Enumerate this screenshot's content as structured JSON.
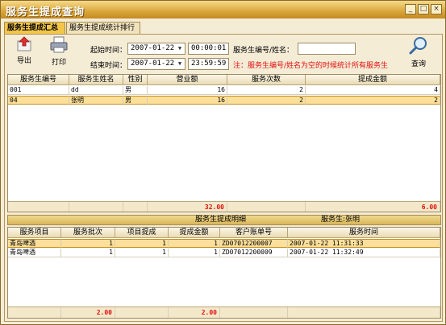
{
  "window": {
    "title": "服务生提成查询",
    "min": "_",
    "max": "□",
    "close": "×"
  },
  "tabs": [
    {
      "label": "服务生提成汇总"
    },
    {
      "label": "服务生提成统计排行"
    }
  ],
  "toolbar": {
    "export_label": "导出",
    "print_label": "打印",
    "query_label": "查询"
  },
  "filters": {
    "start_label": "起始时间：",
    "start_date": "2007-01-22",
    "start_time": "00:00:01",
    "end_label": "结束时间：",
    "end_date": "2007-01-22",
    "end_time": "23:59:59",
    "waiter_label": "服务生编号/姓名：",
    "waiter_value": "",
    "note": "注：服务生编号/姓名为空的时候统计所有服务生"
  },
  "summary_table": {
    "columns": [
      "服务生编号",
      "服务生姓名",
      "性别",
      "营业额",
      "服务次数",
      "提成金额"
    ],
    "rows": [
      [
        "001",
        "dd",
        "男",
        "16",
        "2",
        "4"
      ],
      [
        "04",
        "张明",
        "男",
        "16",
        "2",
        "2"
      ]
    ],
    "footer_revenue": "32.00",
    "footer_commission": "6.00"
  },
  "detail_bar": {
    "title": "服务生提成明细",
    "waiter": "服务生:张明"
  },
  "detail_table": {
    "columns": [
      "服务项目",
      "服务批次",
      "项目提成",
      "提成金额",
      "客户账单号",
      "服务时间"
    ],
    "rows": [
      [
        "青岛啤酒",
        "1",
        "1",
        "1",
        "ZD07012200007",
        "2007-01-22 11:31:33"
      ],
      [
        "青岛啤酒",
        "1",
        "1",
        "1",
        "ZD07012200009",
        "2007-01-22 11:32:49"
      ]
    ],
    "footer_batch": "2.00",
    "footer_amount": "2.00"
  },
  "colors": {
    "title_bar": "#d9a63a",
    "selected_row": "#fbdf9a",
    "note_red": "#e01010"
  },
  "icons": [
    "export-icon",
    "print-icon",
    "search-icon",
    "dropdown-arrow-icon"
  ]
}
